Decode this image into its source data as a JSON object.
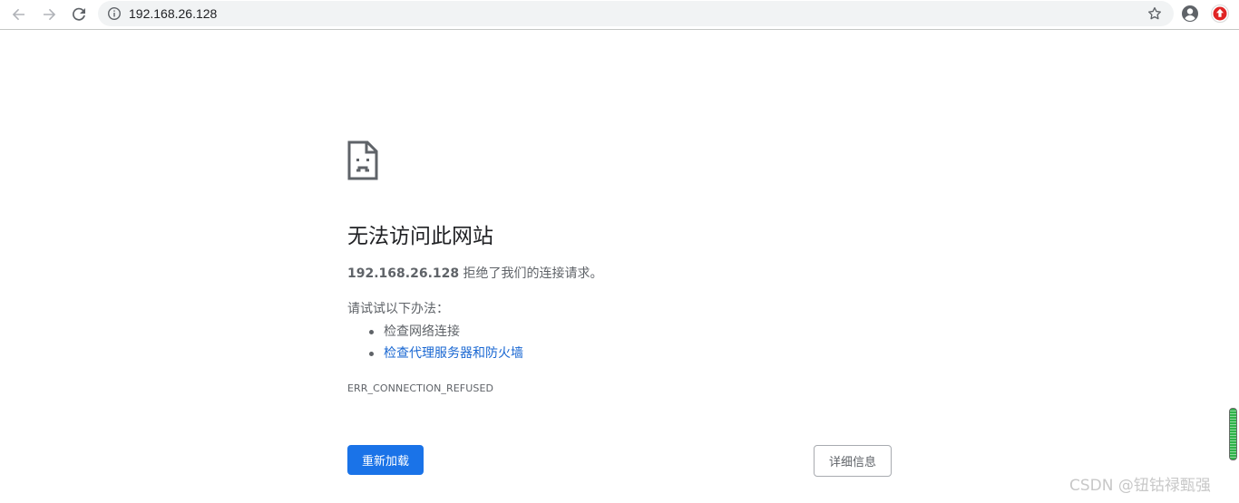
{
  "browser": {
    "url": "192.168.26.128",
    "icons": {
      "back": "arrow-left-icon",
      "forward": "arrow-right-icon",
      "reload": "reload-icon",
      "site_info": "info-icon",
      "bookmark": "star-icon",
      "profile": "account-circle-icon",
      "extension": "red-upload-extension-icon"
    }
  },
  "error_page": {
    "icon": "sad-page-icon",
    "title": "无法访问此网站",
    "host": "192.168.26.128",
    "summary_rest": " 拒绝了我们的连接请求。",
    "suggestions_label": "请试试以下办法：",
    "suggestions": [
      {
        "label": "检查网络连接",
        "link": false
      },
      {
        "label": "检查代理服务器和防火墙",
        "link": true
      }
    ],
    "error_code": "ERR_CONNECTION_REFUSED",
    "reload_label": "重新加载",
    "details_label": "详细信息"
  },
  "colors": {
    "primary_button": "#1a73e8",
    "link": "#1967d2",
    "text": "#5f6368",
    "title": "#202124"
  },
  "watermark": "CSDN @钮钴禄甄强"
}
